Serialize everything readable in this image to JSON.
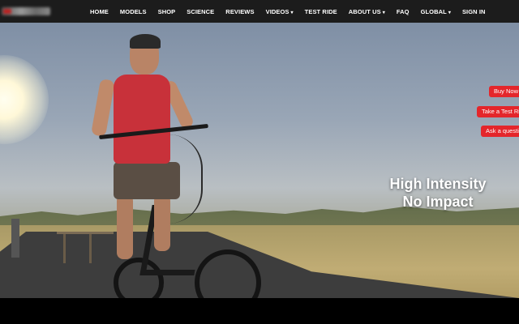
{
  "nav": {
    "items": [
      {
        "label": "HOME",
        "caret": ""
      },
      {
        "label": "MODELS",
        "caret": ""
      },
      {
        "label": "SHOP",
        "caret": ""
      },
      {
        "label": "SCIENCE",
        "caret": ""
      },
      {
        "label": "REVIEWS",
        "caret": ""
      },
      {
        "label": "VIDEOS",
        "caret": "▾"
      },
      {
        "label": "TEST RIDE",
        "caret": ""
      },
      {
        "label": "ABOUT US",
        "caret": "▾"
      },
      {
        "label": "FAQ",
        "caret": ""
      },
      {
        "label": "GLOBAL",
        "caret": "▾"
      },
      {
        "label": "SIGN IN",
        "caret": ""
      }
    ]
  },
  "hero": {
    "caption_line1": "High Intensity",
    "caption_line2": "No Impact"
  },
  "cta": {
    "buy_now": "Buy Now",
    "test_ride": "Take a Test Ride",
    "ask_question": "Ask a question"
  },
  "colors": {
    "nav_bg": "#1c1c1c",
    "cta_red": "#e4262b"
  }
}
